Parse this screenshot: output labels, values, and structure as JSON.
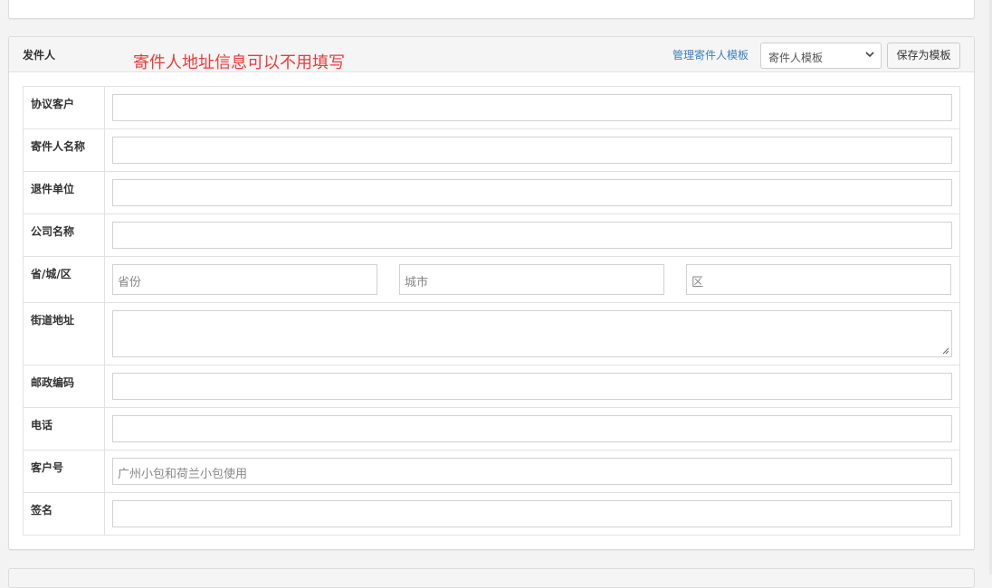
{
  "sender_panel": {
    "title": "发件人",
    "annotation": "寄件人地址信息可以不用填写",
    "manage_link": "管理寄件人模板",
    "template_select": "寄件人模板",
    "save_button": "保存为模板"
  },
  "fields": {
    "protocol_customer": {
      "label": "协议客户",
      "value": ""
    },
    "sender_name": {
      "label": "寄件人名称",
      "value": ""
    },
    "return_unit": {
      "label": "退件单位",
      "value": ""
    },
    "company_name": {
      "label": "公司名称",
      "value": ""
    },
    "region": {
      "label": "省/城/区",
      "province_placeholder": "省份",
      "city_placeholder": "城市",
      "district_placeholder": "区"
    },
    "street_address": {
      "label": "街道地址",
      "value": ""
    },
    "postal_code": {
      "label": "邮政编码",
      "value": ""
    },
    "phone": {
      "label": "电话",
      "value": ""
    },
    "customer_number": {
      "label": "客户号",
      "placeholder": "广州小包和荷兰小包使用"
    },
    "signature": {
      "label": "签名",
      "value": ""
    }
  },
  "colors": {
    "annotation": "#ef3a3a",
    "link": "#3a7fc1"
  }
}
